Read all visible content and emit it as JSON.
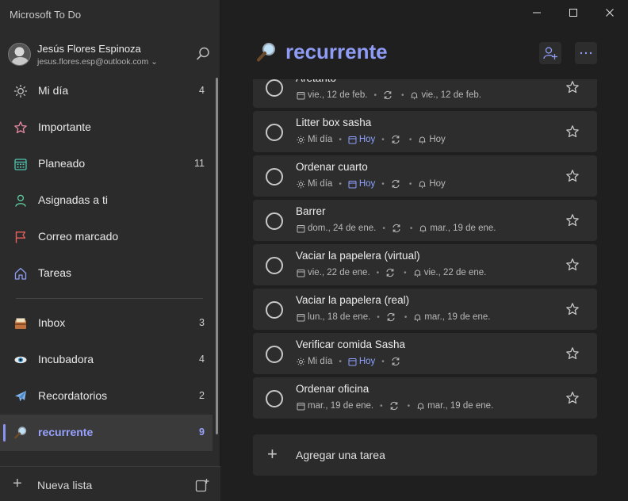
{
  "app": {
    "title": "Microsoft To Do"
  },
  "profile": {
    "name": "Jesús Flores Espinoza",
    "email": "jesus.flores.esp@outlook.com ⌄"
  },
  "sidebar": {
    "smart_lists": [
      {
        "label": "Mi día",
        "count": "4",
        "icon": "sun-icon"
      },
      {
        "label": "Importante",
        "count": "",
        "icon": "star-icon"
      },
      {
        "label": "Planeado",
        "count": "11",
        "icon": "calendar-icon"
      },
      {
        "label": "Asignadas a ti",
        "count": "",
        "icon": "person-icon"
      },
      {
        "label": "Correo marcado",
        "count": "",
        "icon": "flag-icon"
      },
      {
        "label": "Tareas",
        "count": "",
        "icon": "home-icon"
      }
    ],
    "lists": [
      {
        "label": "Inbox",
        "count": "3",
        "icon": "inbox-emoji-icon"
      },
      {
        "label": "Incubadora",
        "count": "4",
        "icon": "eye-emoji-icon"
      },
      {
        "label": "Recordatorios",
        "count": "2",
        "icon": "airplane-emoji-icon"
      },
      {
        "label": "recurrente",
        "count": "9",
        "icon": "magnifier-emoji-icon",
        "active": true
      }
    ],
    "new_list_label": "Nueva lista"
  },
  "main": {
    "title": "recurrente",
    "partial_task_title": "Aretanto",
    "tasks": [
      {
        "title": "Aretanto",
        "meta": [
          {
            "type": "due",
            "text": "vie., 12 de feb."
          },
          {
            "type": "repeat"
          },
          {
            "type": "reminder",
            "text": "vie., 12 de feb."
          }
        ]
      },
      {
        "title": "Litter box sasha",
        "meta": [
          {
            "type": "myday",
            "text": "Mi día"
          },
          {
            "type": "due-hoy",
            "text": "Hoy"
          },
          {
            "type": "repeat"
          },
          {
            "type": "reminder",
            "text": "Hoy"
          }
        ]
      },
      {
        "title": "Ordenar cuarto",
        "meta": [
          {
            "type": "myday",
            "text": "Mi día"
          },
          {
            "type": "due-hoy",
            "text": "Hoy"
          },
          {
            "type": "repeat"
          },
          {
            "type": "reminder",
            "text": "Hoy"
          }
        ]
      },
      {
        "title": "Barrer",
        "meta": [
          {
            "type": "due",
            "text": "dom., 24 de ene."
          },
          {
            "type": "repeat"
          },
          {
            "type": "reminder",
            "text": "mar., 19 de ene."
          }
        ]
      },
      {
        "title": "Vaciar la papelera (virtual)",
        "meta": [
          {
            "type": "due",
            "text": "vie., 22 de ene."
          },
          {
            "type": "repeat"
          },
          {
            "type": "reminder",
            "text": "vie., 22 de ene."
          }
        ]
      },
      {
        "title": "Vaciar la papelera (real)",
        "meta": [
          {
            "type": "due",
            "text": "lun., 18 de ene."
          },
          {
            "type": "repeat"
          },
          {
            "type": "reminder",
            "text": "mar., 19 de ene."
          }
        ]
      },
      {
        "title": "Verificar comida Sasha",
        "meta": [
          {
            "type": "myday",
            "text": "Mi día"
          },
          {
            "type": "due-hoy",
            "text": "Hoy"
          },
          {
            "type": "repeat"
          }
        ]
      },
      {
        "title": "Ordenar oficina",
        "meta": [
          {
            "type": "due",
            "text": "mar., 19 de ene."
          },
          {
            "type": "repeat"
          },
          {
            "type": "reminder",
            "text": "mar., 19 de ene."
          }
        ]
      }
    ],
    "add_task_label": "Agregar una tarea"
  },
  "colors": {
    "accent": "#8f9cf5",
    "background": "#1f1f1f",
    "sidebar": "#2b2b2b",
    "card": "#2d2d2d"
  }
}
